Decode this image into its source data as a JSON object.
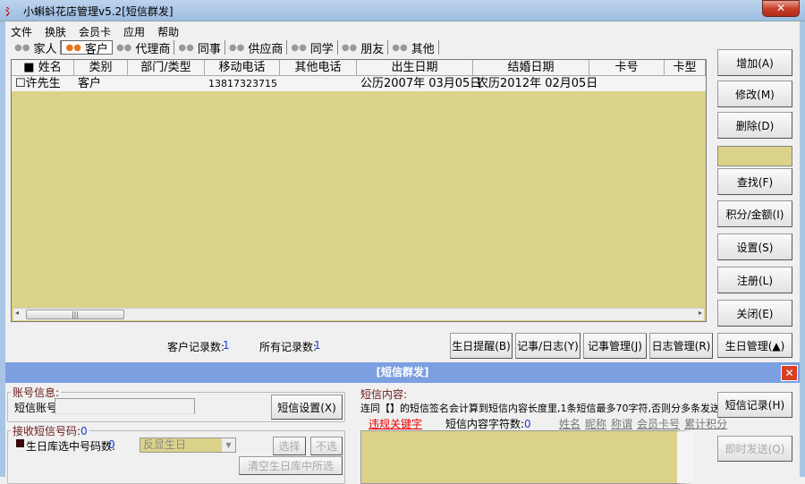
{
  "window": {
    "title": "小蝌蚪花店管理v5.2[短信群发]",
    "close": "✕"
  },
  "menu": [
    "文件",
    "换肤",
    "会员卡",
    "应用",
    "帮助"
  ],
  "tabs": [
    {
      "label": "家人"
    },
    {
      "label": "客户",
      "active": true
    },
    {
      "label": "代理商"
    },
    {
      "label": "同事"
    },
    {
      "label": "供应商"
    },
    {
      "label": "同学"
    },
    {
      "label": "朋友"
    },
    {
      "label": "其他"
    }
  ],
  "grid": {
    "columns": [
      "■  姓名",
      "类别",
      "部门/类型",
      "移动电话",
      "其他电话",
      "出生日期",
      "结婚日期",
      "卡号",
      "卡型"
    ],
    "rows": [
      [
        "☐许先生",
        "客户",
        "",
        "13817323715",
        "",
        "公历2007年  03月05日",
        "农历2012年  02月05日",
        "",
        ""
      ]
    ],
    "scroll_grip": "|||"
  },
  "side_buttons": [
    "增加(A)",
    "修改(M)",
    "删除(D)",
    "查找(F)",
    "积分/金额(I)",
    "设置(S)",
    "注册(L)",
    "关闭(E)",
    "生日管理(▲)"
  ],
  "status": {
    "customer_label": "客户记录数:",
    "customer_count": "1",
    "all_label": "所有记录数:",
    "all_count": "1"
  },
  "bottom_buttons": [
    "生日提醒(B)",
    "记事/日志(Y)",
    "记事管理(J)",
    "日志管理(R)"
  ],
  "sms": {
    "title": "[短信群发]",
    "account_group": "账号信息:",
    "account_label": "短信账号",
    "account_value": "",
    "settings_button": "短信设置(X)",
    "receive_group": "接收短信号码:",
    "receive_count": "0",
    "birthday_label": "生日库选中号码数:",
    "birthday_count": "0",
    "birthday_select": "反显生日",
    "select_button": "选择",
    "deselect_button": "不选",
    "clear_button": "清空生日库中所选",
    "content_label": "短信内容:",
    "content_note": "连同【】的短信签名会计算到短信内容长度里,1条短信最多70字符,否则分多条发送.",
    "forbidden_link": "违规关键字",
    "char_count_label": "短信内容字符数:",
    "char_count": "0",
    "insert_fields": [
      "姓名",
      "昵称",
      "称谓",
      "会员卡号",
      "累计积分"
    ],
    "record_button": "短信记录(H)",
    "send_button": "即时发送(Q)"
  },
  "colors": {
    "grid_bg": "#dcd38a",
    "sms_header": "#7b9fe0",
    "count": "#1a3ad0"
  }
}
